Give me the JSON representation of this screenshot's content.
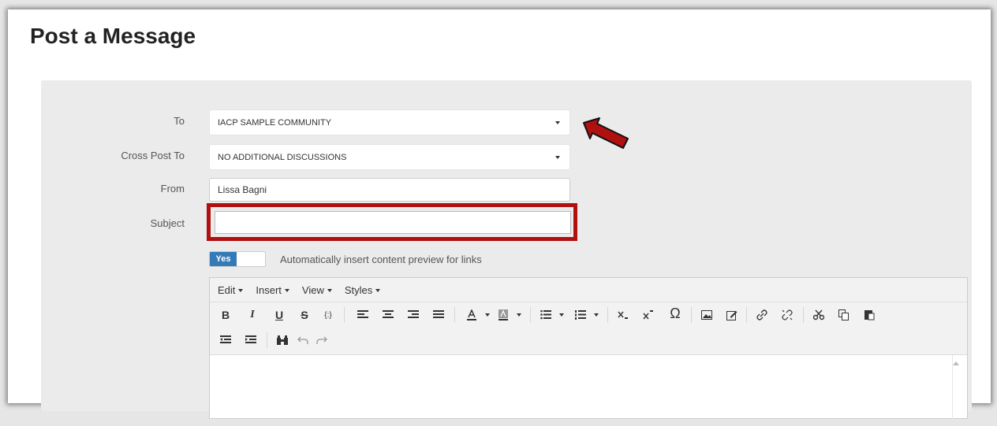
{
  "page": {
    "title": "Post a Message"
  },
  "form": {
    "to_label": "To",
    "to_value": "IACP SAMPLE COMMUNITY",
    "cross_post_label": "Cross Post To",
    "cross_post_value": "NO ADDITIONAL DISCUSSIONS",
    "from_label": "From",
    "from_value": "Lissa Bagni",
    "subject_label": "Subject",
    "subject_value": ""
  },
  "toggle": {
    "on_label": "Yes",
    "description": "Automatically insert content preview for links"
  },
  "editor": {
    "menus": [
      "Edit",
      "Insert",
      "View",
      "Styles"
    ],
    "toolbar": {
      "bold": "B",
      "italic": "I",
      "underline": "U",
      "strike": "S",
      "code": "{:}"
    }
  },
  "colors": {
    "annotation_red": "#b01010",
    "toggle_blue": "#337ab7"
  }
}
